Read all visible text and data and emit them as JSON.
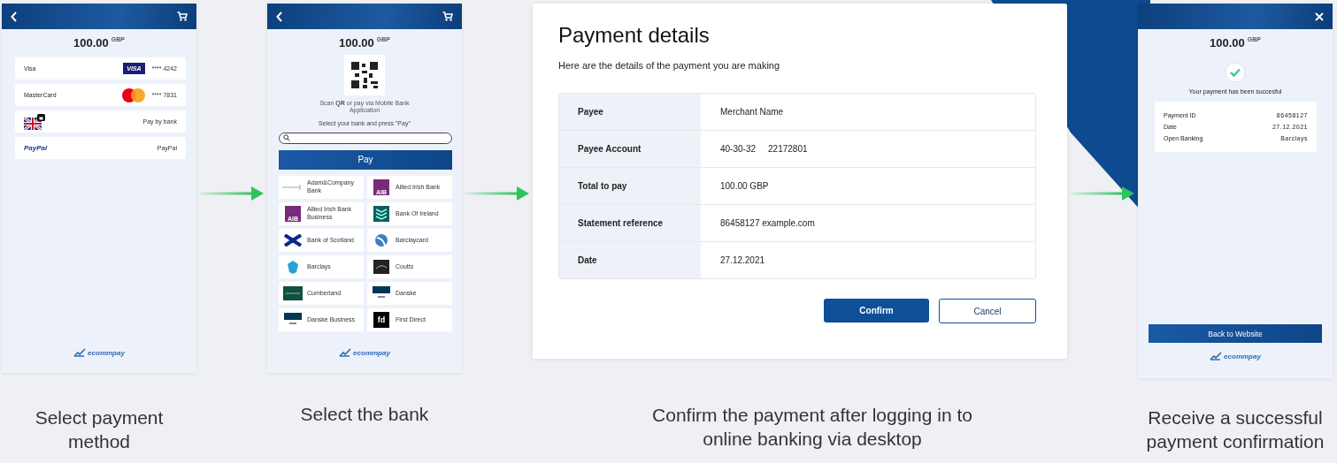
{
  "screen_methods": {
    "amount": "100.00",
    "currency": "GBP",
    "methods": [
      {
        "kind": "visa",
        "name": "Visa",
        "logo_text": "VISA",
        "detail": "**** 4242"
      },
      {
        "kind": "mastercard",
        "name": "MasterCard",
        "detail": "**** 7831"
      },
      {
        "kind": "bank",
        "detail": "Pay by bank"
      },
      {
        "kind": "paypal",
        "logo_text": "PayPal",
        "detail": "PayPal"
      }
    ],
    "brand": "ecommpay"
  },
  "screen_bank": {
    "amount": "100.00",
    "currency": "GBP",
    "scan_text": "Scan **QR** or pay via Mobile Bank Application",
    "instruction": "Select your bank and press \"Pay\"",
    "pay_button": "Pay",
    "banks": [
      {
        "kind": "line",
        "name": "Adam&Company Bank"
      },
      {
        "kind": "aib",
        "logo_text": "AIB",
        "name": "Allied Irish Bank"
      },
      {
        "kind": "aib",
        "logo_text": "AIB",
        "name": "Allied Irish Bank Business"
      },
      {
        "kind": "chevrons",
        "name": "Bank Of Ireland"
      },
      {
        "kind": "saltire",
        "name": "Bank of Scotland"
      },
      {
        "kind": "swirl",
        "name": "Barclaycard"
      },
      {
        "kind": "eagle",
        "name": "Barclays"
      },
      {
        "kind": "dark",
        "name": "Coutts"
      },
      {
        "kind": "green",
        "name": "Cumberland"
      },
      {
        "kind": "danske",
        "name": "Danske"
      },
      {
        "kind": "danske",
        "name": "Danske Business"
      },
      {
        "kind": "fd",
        "logo_text": "fd",
        "name": "First Direct"
      }
    ],
    "brand": "ecommpay"
  },
  "dialog": {
    "title": "Payment details",
    "subtitle": "Here are the details of the payment you are making",
    "rows": [
      {
        "label": "Payee",
        "values": [
          "Merchant Name"
        ]
      },
      {
        "label": "Payee Account",
        "values": [
          "40-30-32",
          "22172801"
        ]
      },
      {
        "label": "Total to pay",
        "values": [
          "100.00 GBP"
        ]
      },
      {
        "label": "Statement reference",
        "values": [
          "86458127 example.com"
        ]
      },
      {
        "label": "Date",
        "values": [
          "27.12.2021"
        ]
      }
    ],
    "confirm": "Confirm",
    "cancel": "Cancel"
  },
  "screen_success": {
    "amount": "100.00",
    "currency": "GBP",
    "message": "Your payment has been succesful",
    "details": [
      {
        "label": "Payment ID",
        "value": "86458127"
      },
      {
        "label": "Date",
        "value": "27.12.2021"
      },
      {
        "label": "Open Banking",
        "value": "Barclays"
      }
    ],
    "button": "Back to Website",
    "brand": "ecommpay"
  },
  "captions": [
    "Select payment method",
    "Select the bank",
    "Confirm the payment after logging in to online banking via desktop",
    "Receive a successful payment confirmation"
  ]
}
